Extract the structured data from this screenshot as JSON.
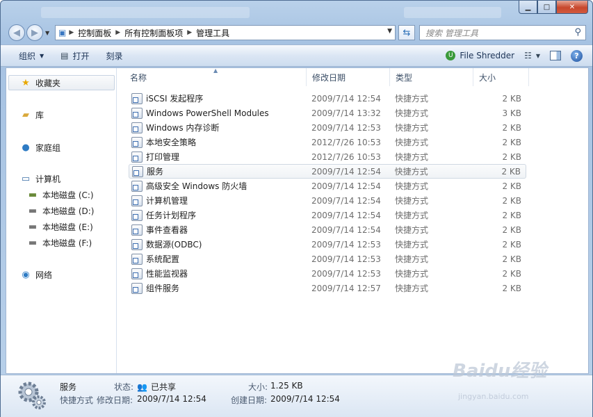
{
  "nav": {
    "breadcrumb": [
      "控制面板",
      "所有控制面板项",
      "管理工具"
    ],
    "search_placeholder": "搜索 管理工具"
  },
  "toolbar": {
    "organize": "组织",
    "open": "打开",
    "burn": "刻录",
    "file_shredder": "File Shredder"
  },
  "sidebar": {
    "favorites": "收藏夹",
    "libraries": "库",
    "homegroup": "家庭组",
    "computer": "计算机",
    "drives": [
      "本地磁盘 (C:)",
      "本地磁盘 (D:)",
      "本地磁盘 (E:)",
      "本地磁盘 (F:)"
    ],
    "network": "网络"
  },
  "columns": {
    "name": "名称",
    "date": "修改日期",
    "type": "类型",
    "size": "大小"
  },
  "files": [
    {
      "name": "iSCSI 发起程序",
      "date": "2009/7/14 12:54",
      "type": "快捷方式",
      "size": "2 KB"
    },
    {
      "name": "Windows PowerShell Modules",
      "date": "2009/7/14 13:32",
      "type": "快捷方式",
      "size": "3 KB"
    },
    {
      "name": "Windows 内存诊断",
      "date": "2009/7/14 12:53",
      "type": "快捷方式",
      "size": "2 KB"
    },
    {
      "name": "本地安全策略",
      "date": "2012/7/26 10:53",
      "type": "快捷方式",
      "size": "2 KB"
    },
    {
      "name": "打印管理",
      "date": "2012/7/26 10:53",
      "type": "快捷方式",
      "size": "2 KB"
    },
    {
      "name": "服务",
      "date": "2009/7/14 12:54",
      "type": "快捷方式",
      "size": "2 KB"
    },
    {
      "name": "高级安全 Windows 防火墙",
      "date": "2009/7/14 12:54",
      "type": "快捷方式",
      "size": "2 KB"
    },
    {
      "name": "计算机管理",
      "date": "2009/7/14 12:54",
      "type": "快捷方式",
      "size": "2 KB"
    },
    {
      "name": "任务计划程序",
      "date": "2009/7/14 12:54",
      "type": "快捷方式",
      "size": "2 KB"
    },
    {
      "name": "事件查看器",
      "date": "2009/7/14 12:54",
      "type": "快捷方式",
      "size": "2 KB"
    },
    {
      "name": "数据源(ODBC)",
      "date": "2009/7/14 12:53",
      "type": "快捷方式",
      "size": "2 KB"
    },
    {
      "name": "系统配置",
      "date": "2009/7/14 12:53",
      "type": "快捷方式",
      "size": "2 KB"
    },
    {
      "name": "性能监视器",
      "date": "2009/7/14 12:53",
      "type": "快捷方式",
      "size": "2 KB"
    },
    {
      "name": "组件服务",
      "date": "2009/7/14 12:57",
      "type": "快捷方式",
      "size": "2 KB"
    }
  ],
  "selected_row": 5,
  "details": {
    "name": "服务",
    "type": "快捷方式",
    "status_label": "状态:",
    "status_value": "已共享",
    "modified_label": "修改日期:",
    "modified_value": "2009/7/14 12:54",
    "size_label": "大小:",
    "size_value": "1.25 KB",
    "created_label": "创建日期:",
    "created_value": "2009/7/14 12:54"
  },
  "watermark": {
    "brand": "Baidu经验",
    "url": "jingyan.baidu.com"
  }
}
